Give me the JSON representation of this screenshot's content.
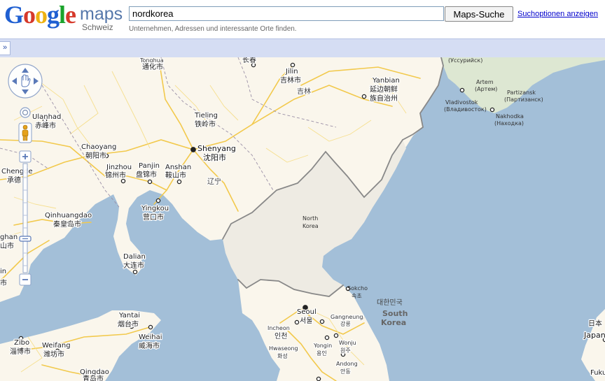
{
  "header": {
    "logo_text": "Google",
    "logo_maps": "maps",
    "logo_region": "Schweiz",
    "search_value": "nordkorea",
    "search_button": "Maps-Suche",
    "options_link": "Suchoptionen anzeigen",
    "hint": "Unternehmen, Adressen und interessante Orte finden."
  },
  "panel": {
    "expand_label": "»"
  },
  "colors": {
    "sea": "#a3bfd8",
    "land": "#faf6ec",
    "nk_land": "#eeebe3",
    "russia_land": "#dde7d2",
    "road_major": "#f7d66a",
    "road_minor": "#fbe9a6"
  },
  "map": {
    "labels": {
      "tonghua": "Tonghua",
      "tonghua_zh": "通化市",
      "changchun_zh": "长春",
      "jilin": "Jilin",
      "jilin_zh": "吉林市",
      "jilin_prov": "吉林",
      "yanbian": "Yanbian",
      "yanbian_zh1": "延边朝鲜",
      "yanbian_zh2": "族自治州",
      "ussuriysk": "(Уссурийск)",
      "artem": "Artem",
      "artem_ru": "(Артем)",
      "partizansk": "Partizansk",
      "partizansk_ru": "(Партизанск)",
      "vladivostok": "Vladivostok",
      "vladivostok_ru": "(Владивосток)",
      "nakhodka": "Nakhodka",
      "nakhodka_ru": "(Находка)",
      "ulanhad": "Ulanhad",
      "ulanhad_zh": "赤峰市",
      "tieling": "Tieling",
      "tieling_zh": "铁岭市",
      "chaoyang": "Chaoyang",
      "chaoyang_zh": "朝阳市",
      "shenyang": "Shenyang",
      "shenyang_zh": "沈阳市",
      "jinzhou": "Jinzhou",
      "jinzhou_zh": "锦州市",
      "panjin": "Panjin",
      "panjin_zh": "盘锦市",
      "anshan": "Anshan",
      "anshan_zh": "鞍山市",
      "chengde": "Chengde",
      "chengde_zh": "承德",
      "liaoning": "辽宁",
      "yingkou": "Yingkou",
      "yingkou_zh": "营口市",
      "qinhuangdao": "Qinhuangdao",
      "qinhuangdao_zh": "秦皇岛市",
      "north_korea_1": "North",
      "north_korea_2": "Korea",
      "dalian": "Dalian",
      "dalian_zh": "大连市",
      "sokcho": "Sokcho",
      "sokcho_ko": "속초",
      "south_korea_ko": "대한민국",
      "south_korea_1": "South",
      "south_korea_2": "Korea",
      "seoul": "Seoul",
      "seoul_ko": "서울",
      "gangneung": "Gangneung",
      "gangneung_ko": "강릉",
      "incheon": "Incheon",
      "incheon_ko": "인천",
      "hwaseong": "Hwaseong",
      "hwaseong_ko": "화성",
      "yongin": "Yongin",
      "yongin_ko": "용인",
      "wonju": "Wonju",
      "wonju_ko": "원주",
      "andong": "Andong",
      "andong_ko": "안동",
      "yantai": "Yantai",
      "yantai_zh": "烟台市",
      "weihai": "Weihai",
      "weihai_zh": "威海市",
      "weifang": "Weifang",
      "weifang_zh": "潍坊市",
      "zibo": "Zibo",
      "zibo_zh": "淄博市",
      "qingdao": "Qingdao",
      "qingdao_zh": "青岛市",
      "japan_zh": "日本",
      "japan": "Japan",
      "fukuoka": "Fuku",
      "edge_shan": "ghan",
      "edge_shan_zh": "山市",
      "edge_jin": "in",
      "edge_jin_zh": "市"
    }
  }
}
